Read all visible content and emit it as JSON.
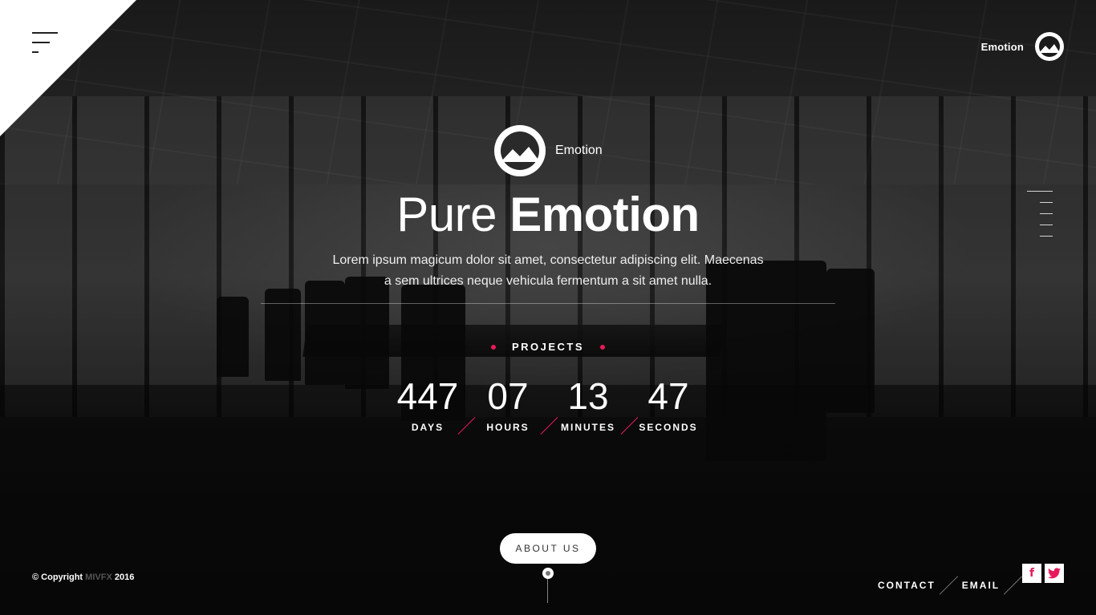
{
  "brand": {
    "name": "Emotion"
  },
  "hero": {
    "logo_name": "Emotion",
    "title_light": "Pure",
    "title_bold": "Emotion",
    "description_line1": "Lorem ipsum magicum dolor sit amet, consectetur adipiscing elit. Maecenas",
    "description_line2": "a sem ultrices neque vehicula fermentum a sit amet nulla."
  },
  "projects": {
    "label": "PROJECTS"
  },
  "countdown": [
    {
      "value": "447",
      "label": "DAYS"
    },
    {
      "value": "07",
      "label": "HOURS"
    },
    {
      "value": "13",
      "label": "MINUTES"
    },
    {
      "value": "47",
      "label": "SECONDS"
    }
  ],
  "about": {
    "label": "ABOUT US"
  },
  "footer": {
    "copyright_prefix": "© Copyright",
    "copyright_brand": "MIVFX",
    "copyright_year": "2016",
    "links": [
      "CONTACT",
      "EMAIL"
    ],
    "social": [
      {
        "icon": "facebook-icon",
        "glyph": "f"
      },
      {
        "icon": "twitter-icon",
        "glyph": "t"
      }
    ]
  },
  "colors": {
    "accent": "#e8195a",
    "background": "#1a1a1a",
    "text": "#ffffff"
  }
}
